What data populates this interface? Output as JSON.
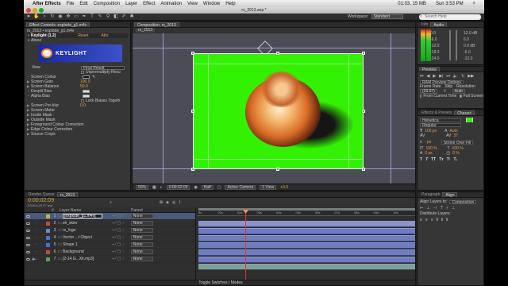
{
  "menubar": {
    "apple": "",
    "app_name": "After Effects",
    "items": [
      "File",
      "Edit",
      "Composition",
      "Layer",
      "Effect",
      "Animation",
      "View",
      "Window",
      "Help"
    ],
    "status": "01:03, 15 MB",
    "clock": "Sun 3:53 PM"
  },
  "window": {
    "title": "rs_2013.aep *"
  },
  "toolbar": {
    "workspace_label": "Workspace:",
    "workspace_value": "Standard",
    "search_placeholder": "Search Help"
  },
  "effect_controls": {
    "tab": "Effect Controls: explode_g1.m4v",
    "crumb": "rs_2013 • explode_g1.m4v",
    "effect_name": "Keylight (1.2)",
    "reset": "Reset",
    "about_label": "Abo",
    "about_section": "About",
    "logo_text": "KEYLIGHT",
    "rows": {
      "view": {
        "label": "View",
        "value": "Final Result"
      },
      "unpremultiply": "Unpremultiply Resu",
      "screen_colour": "Screen Colour",
      "screen_gain": {
        "label": "Screen Gain",
        "value": "100.0"
      },
      "screen_balance": {
        "label": "Screen Balance",
        "value": "50.0"
      },
      "despill_bias": "Despill Bias",
      "alpha_bias": "Alpha Bias",
      "lock_biases": "Lock Biases Togeth",
      "screen_preblur": {
        "label": "Screen Pre-blur",
        "value": "0.0"
      },
      "sections": [
        "Screen Matte",
        "Inside Mask",
        "Outside Mask",
        "Foreground Colour Correction",
        "Edge Colour Correction",
        "Source Crops"
      ]
    }
  },
  "composition": {
    "tab": "Composition: rs_2013",
    "crumb": "rs_2013",
    "zoom": "50%",
    "timecode": "0:00:02:09",
    "resolution": "Half",
    "camera": "Active Camera",
    "views": "1 View",
    "exposure": "+0.0"
  },
  "info_audio": {
    "tabs": [
      "Info",
      "Audio"
    ],
    "db_left": [
      "0.0",
      "-6.0",
      "-12.0",
      "-18.0",
      "-24.0"
    ],
    "db_right": [
      "12.0 dB",
      "6.0",
      "0.0 dB",
      "-6.0",
      "-12.0"
    ]
  },
  "preview": {
    "tab": "Preview",
    "options": "RAM Preview Options",
    "labels": [
      "Frame Rate",
      "Skip",
      "Resolution"
    ],
    "values": [
      "(29.97)",
      "0",
      "Auto"
    ],
    "from_current": "From Current Time",
    "full_screen": "Full Screen"
  },
  "character": {
    "tabs": [
      "Effects & Presets",
      "Charact"
    ],
    "font": "Helvetica",
    "style": "Regular",
    "size": "100 px",
    "leading": "Auto",
    "tracking": "37",
    "stroke": "Stroke Over Fill",
    "scale_v": "100 %",
    "scale_h": "100 %",
    "baseline": "0 px",
    "tsume": "0 %",
    "stroke_width": "- px",
    "font_label": "T"
  },
  "align": {
    "tabs": [
      "Paragraph",
      "Align"
    ],
    "align_to_label": "Align Layers to:",
    "align_to_value": "Composition",
    "distribute_label": "Distribute Layers:"
  },
  "timeline": {
    "tabs": [
      "Render Queue",
      "rs_2013"
    ],
    "timecode": "0:00:02:09",
    "fps": "00069 (29.97 fps)",
    "columns": {
      "num": "#",
      "name": "Layer Name",
      "parent": "Parent"
    },
    "ruler": [
      "0s",
      "01s",
      "02s",
      "03s",
      "04s",
      "05s",
      "06s",
      "07s",
      "08s",
      "09s",
      "10s"
    ],
    "footer": "Toggle Switches / Modes",
    "layers": [
      {
        "num": "1",
        "name": "[explode_g1.m4v]",
        "parent": "None",
        "color": "#b7b755"
      },
      {
        "num": "2",
        "name": "sh_skier",
        "parent": "None",
        "color": "#c44848"
      },
      {
        "num": "3",
        "name": "rs_logo",
        "parent": "None",
        "color": "#5a8fd4"
      },
      {
        "num": "4",
        "name": "Vector ...t Object",
        "parent": "None",
        "color": "#4a6fd0"
      },
      {
        "num": "5",
        "name": "Shape 1",
        "parent": "None",
        "color": "#4a6fd0"
      },
      {
        "num": "6",
        "name": "Background",
        "parent": "None",
        "color": "#c44848"
      },
      {
        "num": "7",
        "name": "[2-14 G...Xit.mp3]",
        "parent": "None",
        "color": "#5aa05a"
      }
    ]
  },
  "colors": {
    "chroma": "#33f103",
    "accent": "#e0a44c",
    "bar": "#6f7dc0"
  },
  "icons": [
    "apple-icon",
    "search-icon",
    "eye-icon",
    "speaker-icon",
    "play-icon"
  ]
}
